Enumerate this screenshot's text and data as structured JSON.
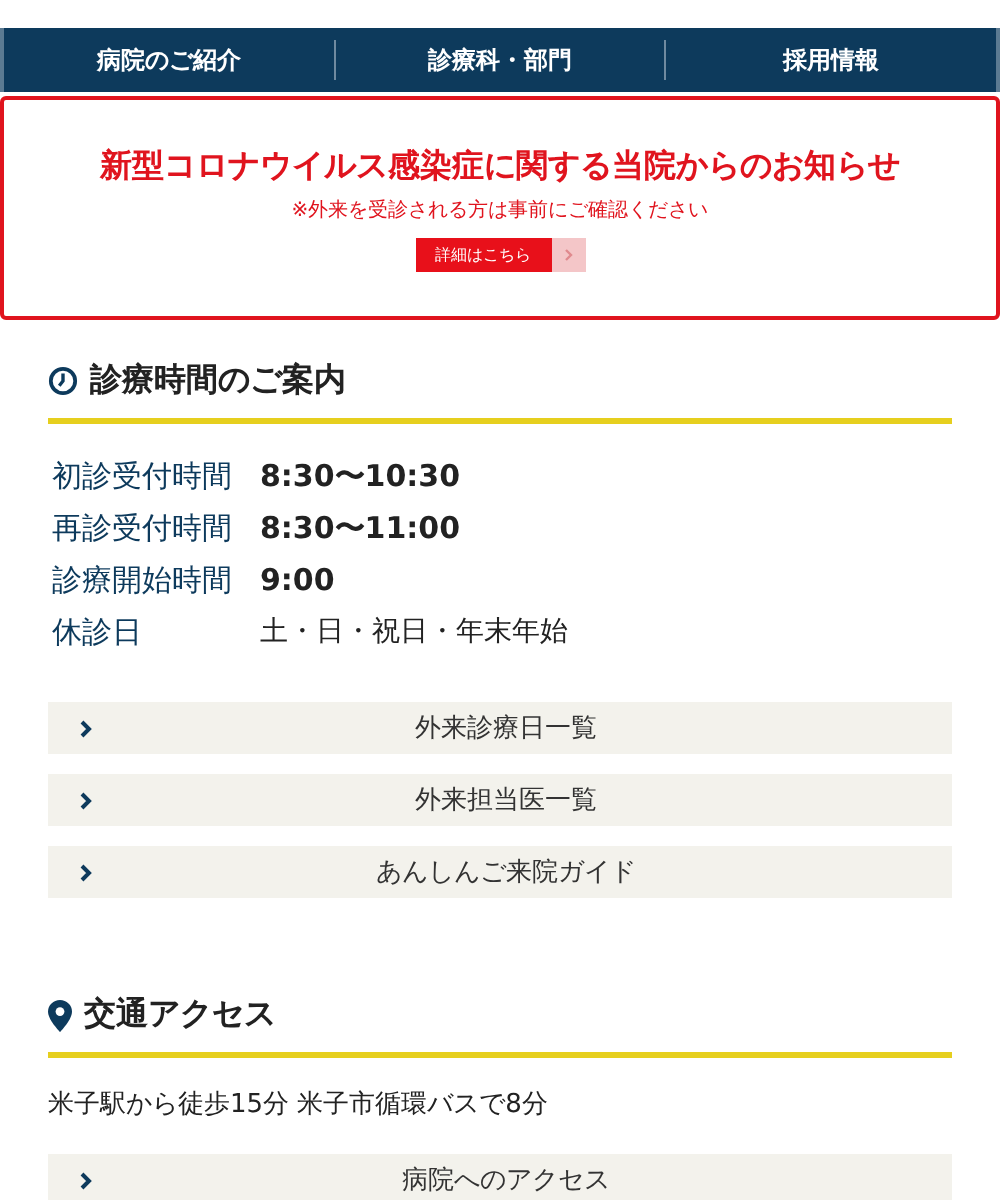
{
  "nav": [
    {
      "label": "病院のご紹介"
    },
    {
      "label": "診療科・部門"
    },
    {
      "label": "採用情報"
    }
  ],
  "notice": {
    "title": "新型コロナウイルス感染症に関する当院からのお知らせ",
    "note": "※外来を受診される方は事前にご確認ください",
    "button": "詳細はこちら"
  },
  "hours": {
    "heading": "診療時間のご案内",
    "rows": [
      {
        "label": "初診受付時間",
        "value": "8:30〜10:30",
        "kind": "time"
      },
      {
        "label": "再診受付時間",
        "value": "8:30〜11:00",
        "kind": "time"
      },
      {
        "label": "診療開始時間",
        "value": "9:00",
        "kind": "time"
      },
      {
        "label": "休診日",
        "value": "土・日・祝日・年末年始",
        "kind": "days"
      }
    ],
    "links": [
      "外来診療日一覧",
      "外来担当医一覧",
      "あんしんご来院ガイド"
    ]
  },
  "access": {
    "heading": "交通アクセス",
    "text": "米子駅から徒歩15分 米子市循環バスで8分",
    "links": [
      "病院へのアクセス"
    ]
  }
}
